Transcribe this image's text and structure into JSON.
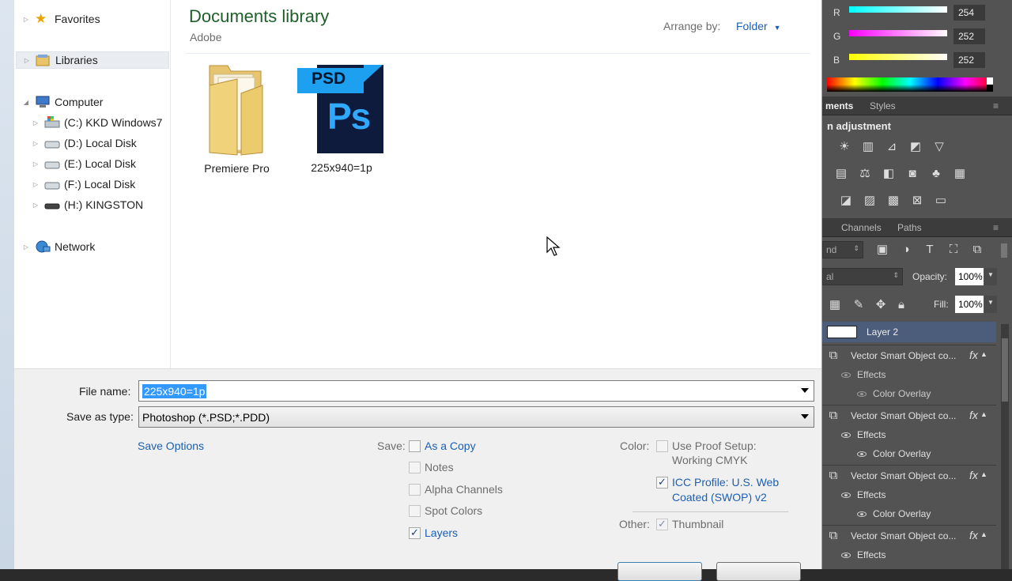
{
  "nav": {
    "items": [
      {
        "label": "Favorites",
        "icon": "star-icon"
      },
      {
        "label": "Libraries",
        "icon": "libraries-icon"
      },
      {
        "label": "Computer",
        "icon": "computer-icon"
      },
      {
        "label": "(C:) KKD Windows7 ",
        "icon": "drive-c-icon"
      },
      {
        "label": "(D:) Local Disk",
        "icon": "drive-icon"
      },
      {
        "label": "(E:) Local Disk",
        "icon": "drive-icon"
      },
      {
        "label": "(F:) Local Disk",
        "icon": "drive-icon"
      },
      {
        "label": "(H:) KINGSTON",
        "icon": "usb-drive-icon"
      },
      {
        "label": "Network",
        "icon": "network-icon"
      }
    ]
  },
  "library": {
    "title": "Documents library",
    "subtitle": "Adobe",
    "arrange_label": "Arrange by:",
    "arrange_value": "Folder"
  },
  "files": [
    {
      "name": "Premiere Pro",
      "icon": "folder-icon"
    },
    {
      "name": "225x940=1p",
      "icon": "psd-file-icon",
      "badge": "PSD",
      "mark": "Ps"
    }
  ],
  "form": {
    "file_name_label": "File name:",
    "file_name_value": "225x940=1p",
    "save_type_label": "Save as type:",
    "save_type_value": "Photoshop (*.PSD;*.PDD)",
    "save_options_link": "Save Options",
    "save_label": "Save:",
    "as_a_copy": "As a Copy",
    "notes": "Notes",
    "alpha_channels": "Alpha Channels",
    "spot_colors": "Spot Colors",
    "layers": "Layers",
    "color_label": "Color:",
    "proof_line1": "Use Proof Setup:",
    "proof_line2": "Working CMYK",
    "icc_line1": "ICC Profile:  U.S. Web",
    "icc_line2": "Coated (SWOP) v2",
    "other_label": "Other:",
    "thumbnail": "Thumbnail"
  },
  "photoshop": {
    "color": {
      "r_label": "R",
      "r_value": "254",
      "g_label": "G",
      "g_value": "252",
      "b_label": "B",
      "b_value": "252"
    },
    "adjust_tabs": {
      "tab1": "ments",
      "tab2": "Styles"
    },
    "adjust_title": "n adjustment",
    "layer_tabs": {
      "tab1": "Channels",
      "tab2": "Paths"
    },
    "blend_short": "nd",
    "mode_short": "al",
    "opacity_label": "Opacity:",
    "opacity_value": "100%",
    "fill_label": "Fill:",
    "fill_value": "100%",
    "layers": [
      {
        "name": "Layer 2"
      },
      {
        "name": "Vector Smart Object co...",
        "fx": "fx",
        "effects": "Effects",
        "effect": "Color Overlay"
      },
      {
        "name": "Vector Smart Object co...",
        "fx": "fx",
        "effects": "Effects",
        "effect": "Color Overlay"
      },
      {
        "name": "Vector Smart Object co...",
        "fx": "fx",
        "effects": "Effects",
        "effect": "Color Overlay"
      },
      {
        "name": "Vector Smart Object co...",
        "fx": "fx",
        "effects": "Effects"
      }
    ]
  }
}
